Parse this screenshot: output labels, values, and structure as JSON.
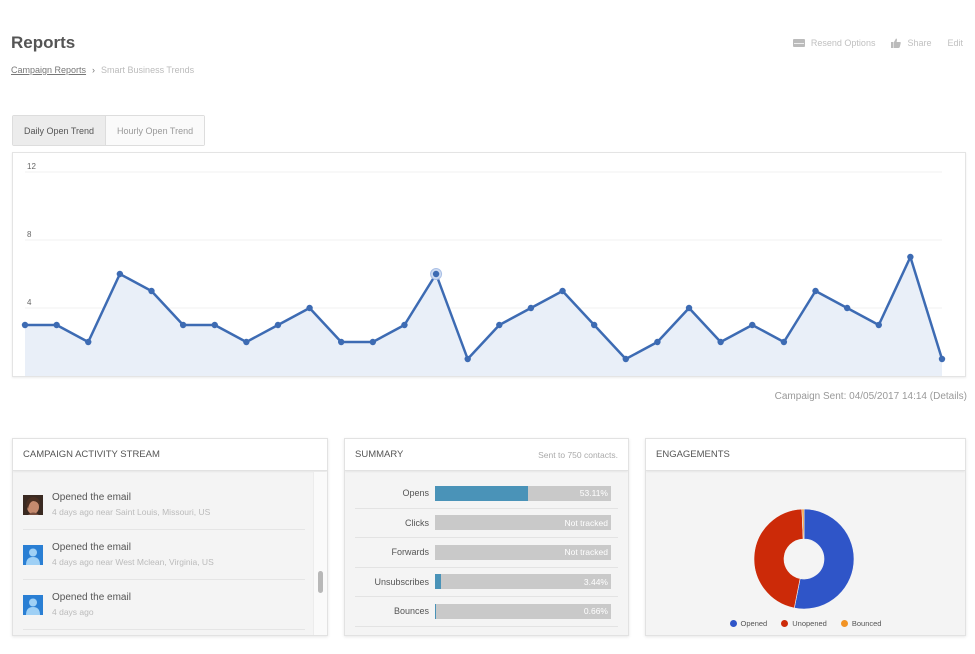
{
  "header": {
    "title": "Reports",
    "breadcrumb": [
      {
        "label": "Campaign Reports",
        "link": true
      },
      {
        "label": "Smart Business Trends",
        "link": false
      }
    ],
    "breadcrumb_separator": "›",
    "actions": {
      "resend": "Resend Options",
      "share": "Share",
      "edit": "Edit"
    }
  },
  "tabs": [
    {
      "label": "Daily Open Trend",
      "active": true
    },
    {
      "label": "Hourly Open Trend",
      "active": false
    }
  ],
  "chart_data": {
    "type": "area",
    "title": "",
    "xlabel": "",
    "ylabel": "",
    "ylim": [
      0,
      12
    ],
    "yticks": [
      4,
      8,
      12
    ],
    "grid": true,
    "x": [
      1,
      2,
      3,
      4,
      5,
      6,
      7,
      8,
      9,
      10,
      11,
      12,
      13,
      14,
      15,
      16,
      17,
      18,
      19,
      20,
      21,
      22,
      23,
      24,
      25,
      26,
      27,
      28,
      29,
      30
    ],
    "series": [
      {
        "name": "Daily Opens",
        "color": "#3d6bb3",
        "fill": "#e9eff8",
        "values": [
          3,
          3,
          2,
          6,
          5,
          3,
          3,
          2,
          3,
          4,
          2,
          2,
          3,
          6,
          1,
          3,
          4,
          5,
          3,
          1,
          2,
          4,
          2,
          3,
          2,
          5,
          4,
          3,
          7,
          1
        ],
        "highlighted_index": 13
      }
    ]
  },
  "campaign_sent": {
    "label": "Campaign Sent: 04/05/2017 14:14",
    "details": "(Details)"
  },
  "activity_stream": {
    "title": "CAMPAIGN ACTIVITY STREAM",
    "items": [
      {
        "title": "Opened the email",
        "meta": "4 days ago  near Saint Louis, Missouri, US",
        "avatar": "photo"
      },
      {
        "title": "Opened the email",
        "meta": "4 days ago  near West Mclean, Virginia, US",
        "avatar": "placeholder"
      },
      {
        "title": "Opened the email",
        "meta": "4 days ago",
        "avatar": "placeholder"
      }
    ]
  },
  "summary": {
    "title": "SUMMARY",
    "subtitle": "Sent to 750 contacts.",
    "rows": [
      {
        "label": "Opens",
        "value": "53.11%",
        "fraction": 0.5311
      },
      {
        "label": "Clicks",
        "value": "Not tracked",
        "fraction": 0
      },
      {
        "label": "Forwards",
        "value": "Not tracked",
        "fraction": 0
      },
      {
        "label": "Unsubscribes",
        "value": "3.44%",
        "fraction": 0.0344
      },
      {
        "label": "Bounces",
        "value": "0.66%",
        "fraction": 0.0066
      }
    ],
    "bar_color": "#4a93b8"
  },
  "engagements": {
    "title": "ENGAGEMENTS",
    "chart": {
      "type": "pie",
      "slices": [
        {
          "label": "Opened",
          "value": 53.11,
          "color": "#2f55c8"
        },
        {
          "label": "Unopened",
          "value": 46.23,
          "color": "#cc2a08"
        },
        {
          "label": "Bounced",
          "value": 0.66,
          "color": "#f29324"
        }
      ]
    }
  }
}
